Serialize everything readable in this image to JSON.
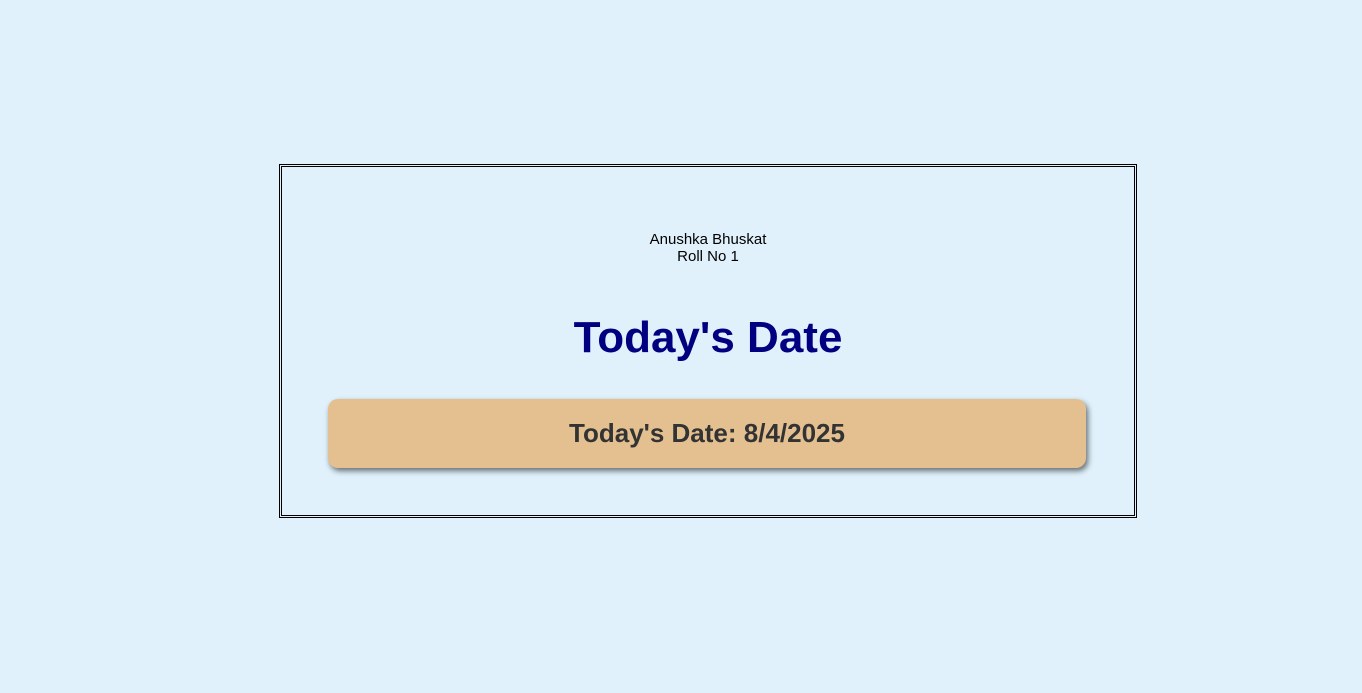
{
  "author": {
    "name": "Anushka Bhuskat",
    "roll": "Roll No 1"
  },
  "heading": "Today's Date",
  "date_display": {
    "label": "Today's Date:",
    "value": "8/4/2025"
  },
  "colors": {
    "background": "#e0f1fc",
    "heading": "#000080",
    "date_box": "#e4c091",
    "date_text": "#333333"
  }
}
